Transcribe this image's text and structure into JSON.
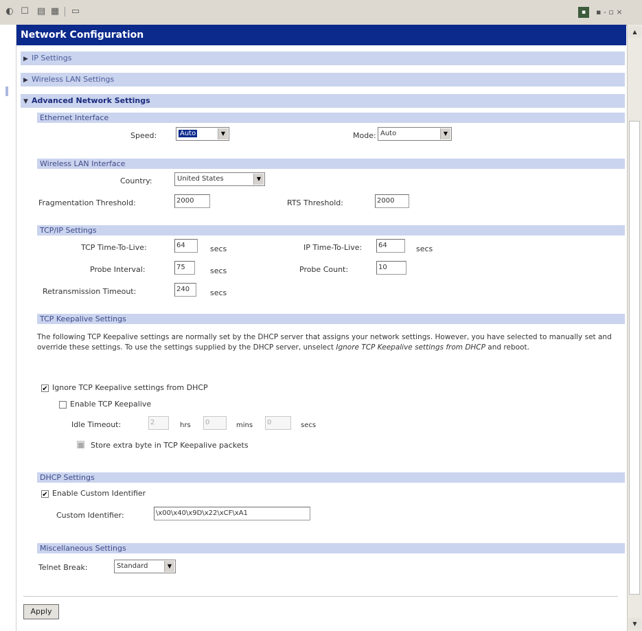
{
  "page_title": "Network Configuration",
  "sections": {
    "ip_settings": "IP Settings",
    "wireless_lan_settings": "Wireless LAN Settings",
    "advanced_network_settings": "Advanced Network Settings"
  },
  "ethernet": {
    "heading": "Ethernet Interface",
    "speed_label": "Speed:",
    "speed_value": "Auto",
    "mode_label": "Mode:",
    "mode_value": "Auto"
  },
  "wireless": {
    "heading": "Wireless LAN Interface",
    "country_label": "Country:",
    "country_value": "United States",
    "frag_label": "Fragmentation Threshold:",
    "frag_value": "2000",
    "rts_label": "RTS Threshold:",
    "rts_value": "2000"
  },
  "tcpip": {
    "heading": "TCP/IP Settings",
    "tcp_ttl_label": "TCP Time-To-Live:",
    "tcp_ttl_value": "64",
    "tcp_ttl_unit": "secs",
    "ip_ttl_label": "IP Time-To-Live:",
    "ip_ttl_value": "64",
    "ip_ttl_unit": "secs",
    "probe_interval_label": "Probe Interval:",
    "probe_interval_value": "75",
    "probe_interval_unit": "secs",
    "probe_count_label": "Probe Count:",
    "probe_count_value": "10",
    "retrans_label": "Retransmission Timeout:",
    "retrans_value": "240",
    "retrans_unit": "secs"
  },
  "keepalive": {
    "heading": "TCP Keepalive Settings",
    "para_part1": "The following TCP Keepalive settings are normally set by the DHCP server that assigns your network settings. However, you have selected to manually set and override these settings. To use the settings supplied by the DHCP server, unselect ",
    "para_emph": "Ignore TCP Keepalive settings from DHCP",
    "para_part2": " and reboot.",
    "ignore_label": "Ignore TCP Keepalive settings from DHCP",
    "enable_label": "Enable TCP Keepalive",
    "idle_label": "Idle Timeout:",
    "idle_hrs_value": "2",
    "hrs_unit": "hrs",
    "idle_mins_value": "0",
    "mins_unit": "mins",
    "idle_secs_value": "0",
    "secs_unit": "secs",
    "store_label": "Store extra byte in TCP Keepalive packets"
  },
  "dhcp": {
    "heading": "DHCP Settings",
    "enable_custom_label": "Enable Custom Identifier",
    "custom_id_label": "Custom Identifier:",
    "custom_id_value": "\\x00\\x40\\x9D\\x22\\xCF\\xA1"
  },
  "misc": {
    "heading": "Miscellaneous Settings",
    "telnet_label": "Telnet Break:",
    "telnet_value": "Standard"
  },
  "apply_label": "Apply",
  "window_controls": "▪ - ▫ ×"
}
